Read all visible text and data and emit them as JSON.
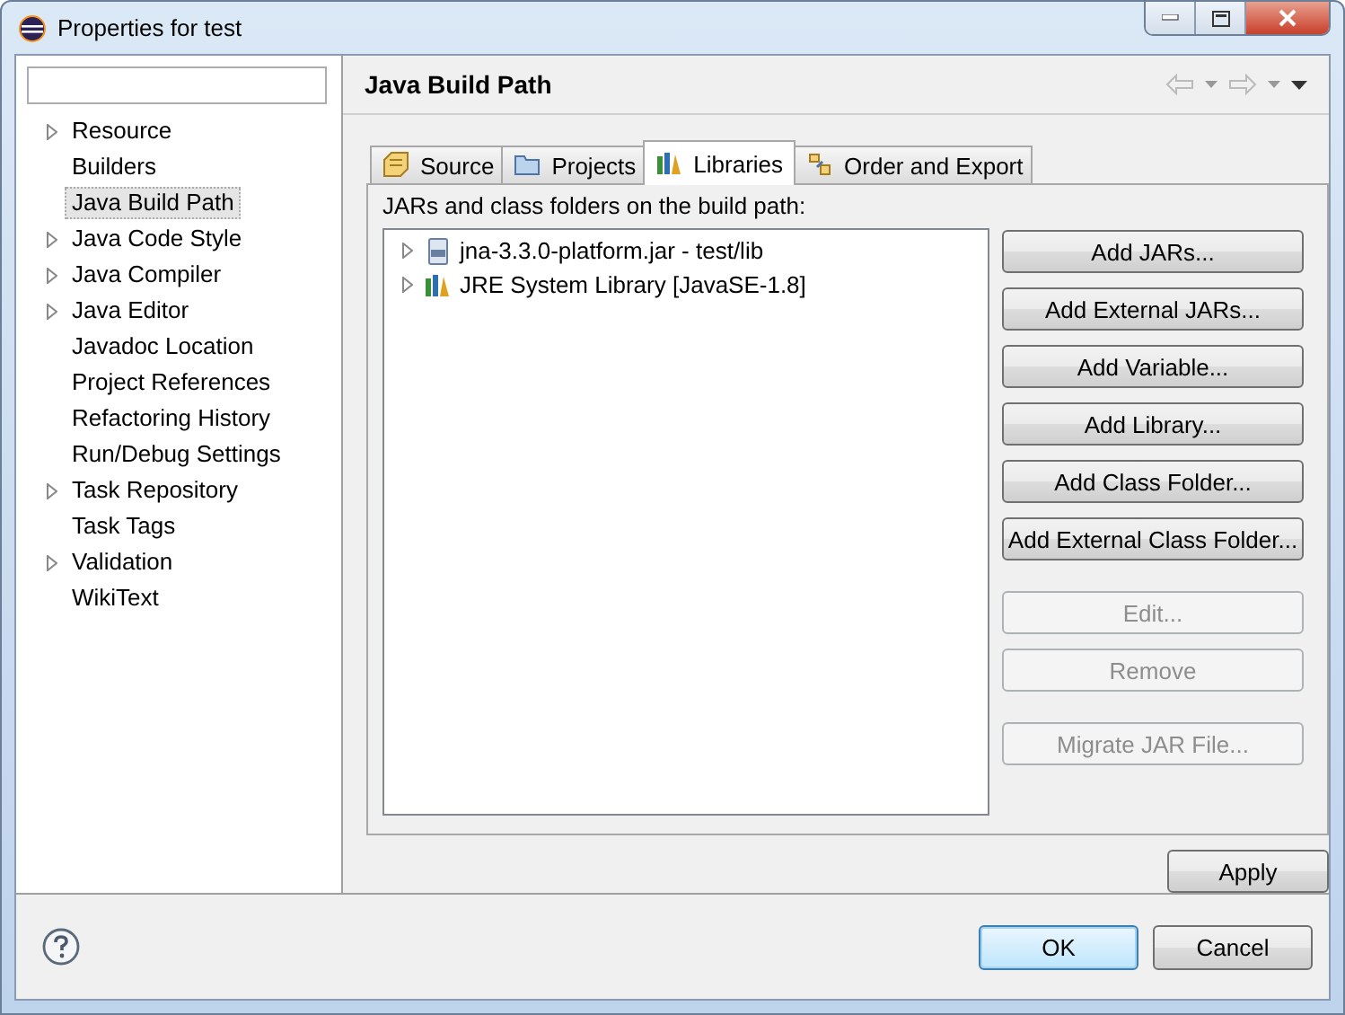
{
  "window": {
    "title": "Properties for test"
  },
  "sidebar": {
    "items": [
      {
        "label": "Resource",
        "expandable": true,
        "selected": false
      },
      {
        "label": "Builders",
        "expandable": false,
        "selected": false
      },
      {
        "label": "Java Build Path",
        "expandable": false,
        "selected": true
      },
      {
        "label": "Java Code Style",
        "expandable": true,
        "selected": false
      },
      {
        "label": "Java Compiler",
        "expandable": true,
        "selected": false
      },
      {
        "label": "Java Editor",
        "expandable": true,
        "selected": false
      },
      {
        "label": "Javadoc Location",
        "expandable": false,
        "selected": false
      },
      {
        "label": "Project References",
        "expandable": false,
        "selected": false
      },
      {
        "label": "Refactoring History",
        "expandable": false,
        "selected": false
      },
      {
        "label": "Run/Debug Settings",
        "expandable": false,
        "selected": false
      },
      {
        "label": "Task Repository",
        "expandable": true,
        "selected": false
      },
      {
        "label": "Task Tags",
        "expandable": false,
        "selected": false
      },
      {
        "label": "Validation",
        "expandable": true,
        "selected": false
      },
      {
        "label": "WikiText",
        "expandable": false,
        "selected": false
      }
    ]
  },
  "page": {
    "title": "Java Build Path",
    "tabs": [
      {
        "label": "Source",
        "kind": "source",
        "selected": false
      },
      {
        "label": "Projects",
        "kind": "projects",
        "selected": false
      },
      {
        "label": "Libraries",
        "kind": "libraries",
        "selected": true
      },
      {
        "label": "Order and Export",
        "kind": "order",
        "selected": false
      }
    ],
    "list_label": "JARs and class folders on the build path:",
    "entries": [
      {
        "label": "jna-3.3.0-platform.jar - test/lib",
        "kind": "jar"
      },
      {
        "label": "JRE System Library [JavaSE-1.8]",
        "kind": "library"
      }
    ],
    "button_groups": [
      [
        {
          "label": "Add JARs...",
          "disabled": false
        },
        {
          "label": "Add External JARs...",
          "disabled": false
        },
        {
          "label": "Add Variable...",
          "disabled": false
        },
        {
          "label": "Add Library...",
          "disabled": false
        },
        {
          "label": "Add Class Folder...",
          "disabled": false
        },
        {
          "label": "Add External Class Folder...",
          "disabled": false
        }
      ],
      [
        {
          "label": "Edit...",
          "disabled": true
        },
        {
          "label": "Remove",
          "disabled": true
        }
      ],
      [
        {
          "label": "Migrate JAR File...",
          "disabled": true
        }
      ]
    ],
    "apply": "Apply"
  },
  "footer": {
    "buttons": [
      {
        "label": "OK",
        "default": true
      },
      {
        "label": "Cancel",
        "default": false
      }
    ]
  }
}
